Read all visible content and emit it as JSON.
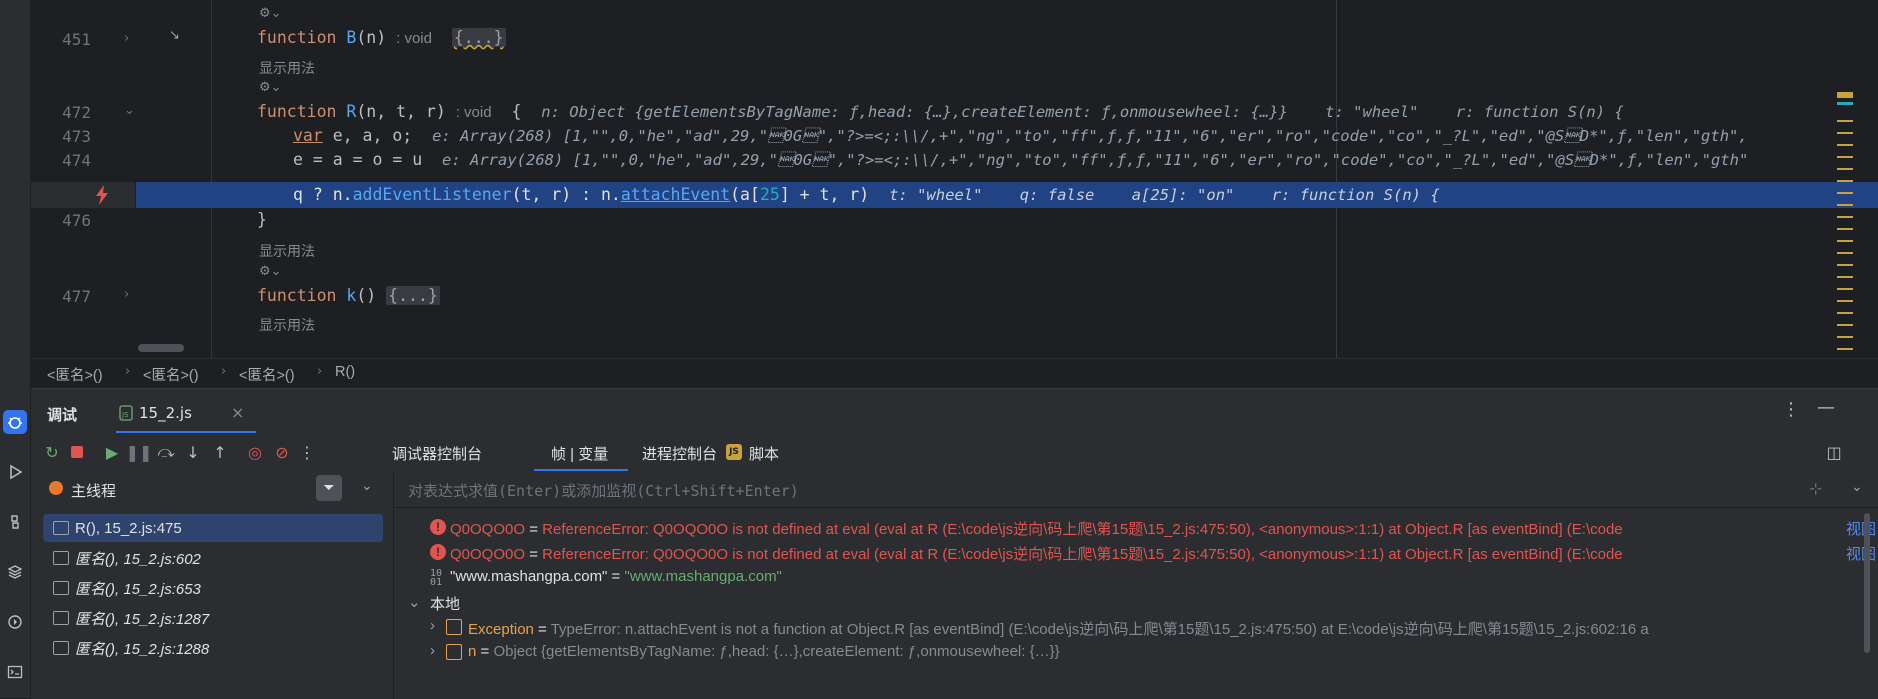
{
  "editor": {
    "lines": {
      "l451": {
        "num": "451",
        "kw": "function",
        "name": "B",
        "params": "(n)",
        "hint": ": void",
        "collapsed": "{...}"
      },
      "usage1": "显示用法",
      "l472": {
        "num": "472",
        "kw": "function",
        "name": "R",
        "params": "(n, t, r)",
        "hint": ": void",
        "brace": "{",
        "inline": "n: Object {getElementsByTagName: ƒ,head: {…},createElement: ƒ,onmousewheel: {…}}    t: \"wheel\"    r: function S(n) {"
      },
      "l473": {
        "num": "473",
        "kw": "var",
        "code": " e, a, o;",
        "inline": "e: Array(268) [1,\"\",0,\"he\",\"ad\",29,\"\u00150G\u0015\",\"?>=<;:\\\\/,+\",\"ng\",\"to\",\"ff\",ƒ,ƒ,\"11\",\"6\",\"er\",\"ro\",\"code\",\"co\",\"_?L\",\"ed\",\"@S\u0015D*\",ƒ,\"len\",\"gth\","
      },
      "l474": {
        "num": "474",
        "code": "e = a = o = u",
        "inline": "e: Array(268) [1,\"\",0,\"he\",\"ad\",29,\"\u00150G\u0015\",\"?>=<;:\\\\/,+\",\"ng\",\"to\",\"ff\",ƒ,ƒ,\"11\",\"6\",\"er\",\"ro\",\"code\",\"co\",\"_?L\",\"ed\",\"@S\u0015D*\",ƒ,\"len\",\"gth\""
      },
      "l475": {
        "code_a": "q ? n.",
        "fn1": "addEventListener",
        "code_b": "(t, r) : n.",
        "fn2": "attachEvent",
        "code_c": "(a[",
        "idx": "25",
        "code_d": "] + t, r)",
        "inline": "t: \"wheel\"    q: false    a[25]: \"on\"    r: function S(n) {"
      },
      "l476": {
        "num": "476",
        "code": "}"
      },
      "usage2": "显示用法",
      "l477": {
        "num": "477",
        "kw": "function",
        "name": "k",
        "params": "()",
        "collapsed": "{...}"
      },
      "usage3": "显示用法"
    }
  },
  "breadcrumb": [
    "<匿名>()",
    "<匿名>()",
    "<匿名>()",
    "R()"
  ],
  "debug": {
    "tab_debug": "调试",
    "tab_file": "15_2.js",
    "toolbar": {
      "console": "调试器控制台",
      "frames_vars": "帧 | 变量",
      "process_console": "进程控制台",
      "scripts": "脚本"
    },
    "thread": "主线程",
    "eval_placeholder": "对表达式求值(Enter)或添加监视(Ctrl+Shift+Enter)",
    "frames": [
      {
        "label": "R(), 15_2.js:475"
      },
      {
        "label": "匿名(), 15_2.js:602"
      },
      {
        "label": "匿名(), 15_2.js:653"
      },
      {
        "label": "匿名(), 15_2.js:1287"
      },
      {
        "label": "匿名(), 15_2.js:1288"
      }
    ],
    "vars": {
      "err1": {
        "name": "Q0OQO0O",
        "eq": " = ",
        "value": "ReferenceError: Q0OQO0O is not defined    at eval (eval at R (E:\\code\\js逆向\\码上爬\\第15题\\15_2.js:475:50), <anonymous>:1:1)    at Object.R [as eventBind] (E:\\code",
        "link": "视图"
      },
      "err2": {
        "name": "Q0OQO0O",
        "eq": " = ",
        "value": "ReferenceError: Q0OQO0O is not defined    at eval (eval at R (E:\\code\\js逆向\\码上爬\\第15题\\15_2.js:475:50), <anonymous>:1:1)    at Object.R [as eventBind] (E:\\code",
        "link": "视图"
      },
      "str": {
        "name": "\"www.mashangpa.com\"",
        "eq": " = ",
        "value": "\"www.mashangpa.com\""
      },
      "local": "本地",
      "exception": {
        "name": "Exception",
        "eq": " = ",
        "value": "TypeError: n.attachEvent is not a function    at Object.R [as eventBind] (E:\\code\\js逆向\\码上爬\\第15题\\15_2.js:475:50)    at E:\\code\\js逆向\\码上爬\\第15题\\15_2.js:602:16    a"
      },
      "n": {
        "name": "n",
        "eq": " = ",
        "value": "Object {getElementsByTagName: ƒ,head: {…},createElement: ƒ,onmousewheel: {…}}"
      }
    }
  },
  "colors": {
    "accent": "#3574f0",
    "exec_line": "#214283",
    "error": "#e0554f"
  }
}
